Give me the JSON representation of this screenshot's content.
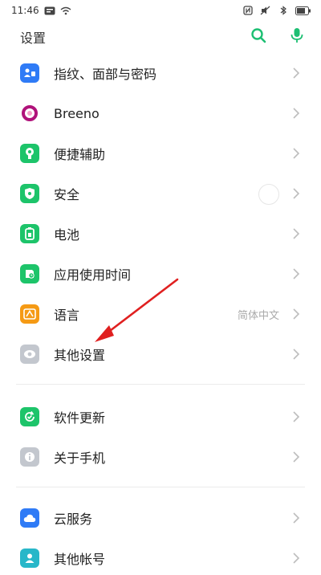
{
  "status": {
    "time": "11:46"
  },
  "header": {
    "title": "设置"
  },
  "items": [
    {
      "label": "指纹、面部与密码",
      "icon": "fingerprint-icon",
      "color": "#2f7bf6"
    },
    {
      "label": "Breeno",
      "icon": "breeno-icon",
      "color": "#b0127a"
    },
    {
      "label": "便捷辅助",
      "icon": "assist-icon",
      "color": "#1dc46a"
    },
    {
      "label": "安全",
      "icon": "shield-icon",
      "color": "#1dc46a"
    },
    {
      "label": "电池",
      "icon": "battery-icon",
      "color": "#1dc46a"
    },
    {
      "label": "应用使用时间",
      "icon": "app-time-icon",
      "color": "#1dc46a"
    },
    {
      "label": "语言",
      "icon": "language-icon",
      "color": "#f59a14",
      "value": "简体中文"
    },
    {
      "label": "其他设置",
      "icon": "other-settings-icon",
      "color": "#b8bcc4"
    },
    {
      "label": "软件更新",
      "icon": "software-update-icon",
      "color": "#1dc46a"
    },
    {
      "label": "关于手机",
      "icon": "about-phone-icon",
      "color": "#b8bcc4"
    },
    {
      "label": "云服务",
      "icon": "cloud-icon",
      "color": "#2f7bf6"
    },
    {
      "label": "其他帐号",
      "icon": "account-icon",
      "color": "#28b7c9"
    }
  ],
  "colors": {
    "accent": "#1dbf73",
    "annotation_arrow": "#e02020"
  }
}
